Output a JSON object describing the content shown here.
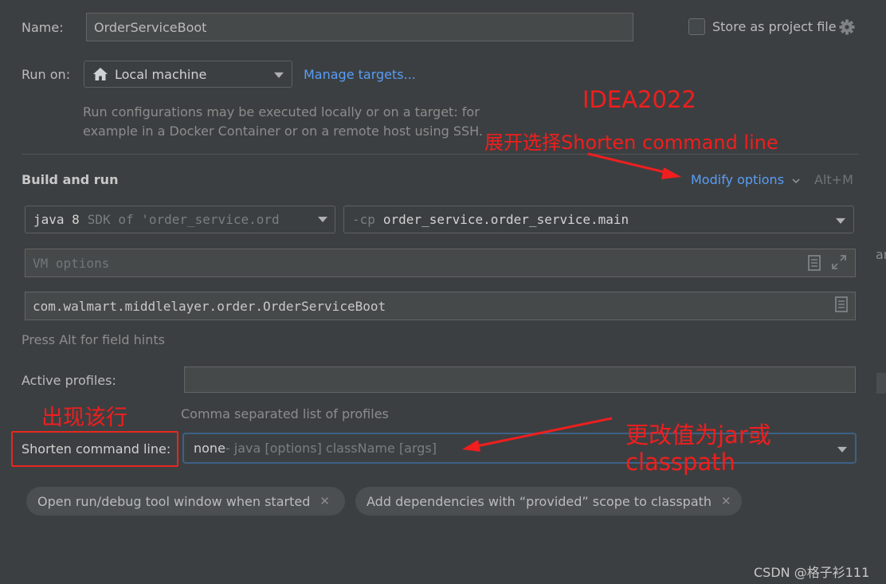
{
  "name": {
    "label": "Name:",
    "value": "OrderServiceBoot"
  },
  "store_as_project_file": {
    "label": "Store as project file",
    "checked": false
  },
  "run_on": {
    "label": "Run on:",
    "selected": "Local machine",
    "manage_link": "Manage targets...",
    "description_line1": "Run configurations may be executed locally or on a target: for",
    "description_line2": "example in a Docker Container or on a remote host using SSH."
  },
  "build_and_run": {
    "title": "Build and run",
    "modify_options": "Modify options",
    "modify_shortcut": "Alt+M",
    "jdk": {
      "version": "java 8",
      "detail": "SDK of 'order_service.ord"
    },
    "classpath": {
      "flag": "-cp",
      "module": "order_service.order_service.main"
    },
    "vm_options_placeholder": "VM options",
    "main_class": "com.walmart.middlelayer.order.OrderServiceBoot",
    "field_hint": "Press Alt for field hints"
  },
  "active_profiles": {
    "label": "Active profiles:",
    "value": "",
    "hint": "Comma separated list of profiles"
  },
  "shorten_command_line": {
    "label": "Shorten command line:",
    "value": "none",
    "value_detail": " - java [options] className [args]"
  },
  "chips": [
    {
      "label": "Open run/debug tool window when started"
    },
    {
      "label": "Add dependencies with “provided” scope to classpath"
    }
  ],
  "annotations": {
    "idea_version": "IDEA2022",
    "expand_select": "展开选择Shorten command line",
    "row_appears": "出现该行",
    "change_value_line1": "更改值为jar或",
    "change_value_line2": "classpath"
  },
  "watermark": "CSDN @格子衫111",
  "colors": {
    "background": "#3c3f41",
    "accent_link": "#589df6",
    "annotation_red": "#f01e1e",
    "focus_border": "#3d6185"
  }
}
